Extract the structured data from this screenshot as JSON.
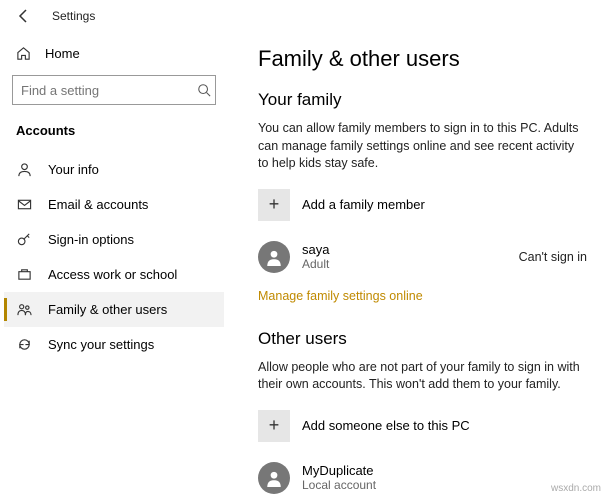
{
  "titlebar": {
    "title": "Settings"
  },
  "sidebar": {
    "home_label": "Home",
    "search_placeholder": "Find a setting",
    "category": "Accounts",
    "items": [
      {
        "label": "Your info"
      },
      {
        "label": "Email & accounts"
      },
      {
        "label": "Sign-in options"
      },
      {
        "label": "Access work or school"
      },
      {
        "label": "Family & other users"
      },
      {
        "label": "Sync your settings"
      }
    ]
  },
  "content": {
    "page_title": "Family & other users",
    "family": {
      "heading": "Your family",
      "description": "You can allow family members to sign in to this PC. Adults can manage family settings online and see recent activity to help kids stay safe.",
      "add_label": "Add a family member",
      "member": {
        "name": "saya",
        "role": "Adult",
        "status": "Can't sign in"
      },
      "manage_link": "Manage family settings online"
    },
    "other": {
      "heading": "Other users",
      "description": "Allow people who are not part of your family to sign in with their own accounts. This won't add them to your family.",
      "add_label": "Add someone else to this PC",
      "user": {
        "name": "MyDuplicate",
        "sub": "Local account"
      }
    }
  },
  "watermark": "wsxdn.com"
}
